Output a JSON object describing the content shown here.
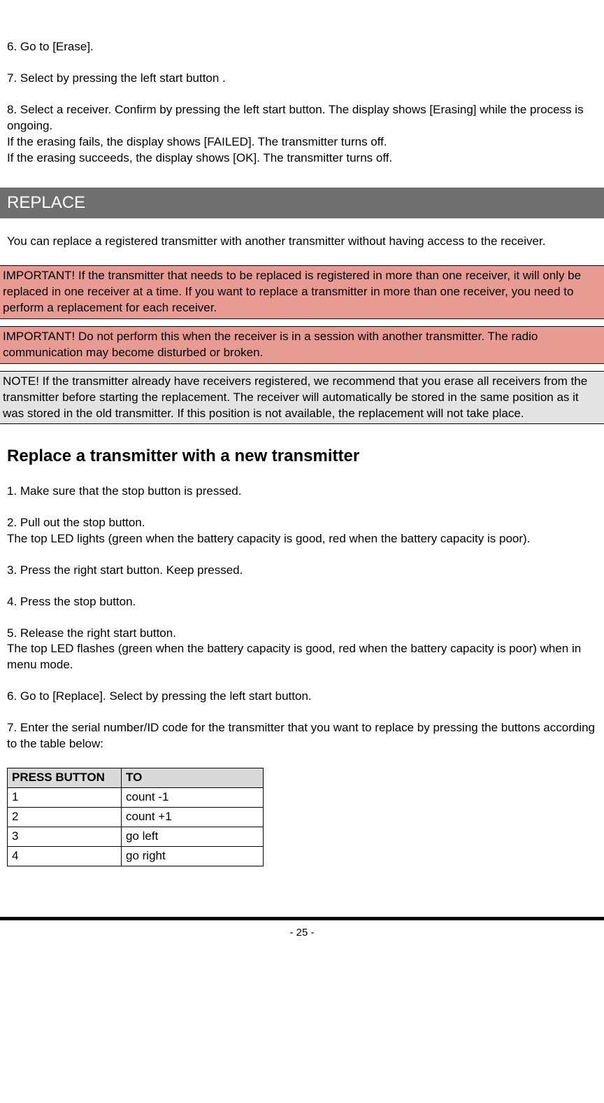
{
  "steps_top": {
    "s6": "6. Go to [Erase].",
    "s7": "7. Select by pressing the left start button .",
    "s8a": "8. Select a receiver. Confirm by pressing the left start button. The display shows [Erasing] while the process is ongoing.",
    "s8b": "If the erasing fails, the display shows [FAILED]. The transmitter turns off.",
    "s8c": "If the erasing succeeds, the display shows [OK]. The transmitter turns off."
  },
  "section_title": "REPLACE",
  "replace_intro": "You can replace a registered transmitter with another transmitter without having access to the receiver.",
  "important1": "IMPORTANT! If the transmitter that needs to be replaced is registered in more than one receiver, it will only be replaced in one receiver at a time. If you want to replace a transmitter in more than one receiver, you need to perform a replacement for each receiver.",
  "important2": "IMPORTANT! Do not perform this when the receiver is in a session with another transmitter. The radio communication may become disturbed or broken.",
  "note1": "NOTE! If the transmitter already have receivers registered, we recommend that you erase all receivers from the transmitter before starting the replacement. The receiver will automatically be stored in the same position as it was stored in the old transmitter. If this position is not available, the replacement will not take place.",
  "subheading": "Replace a transmitter with a new transmitter",
  "replace_steps": {
    "r1": "1. Make sure that the stop button is pressed.",
    "r2a": "2. Pull out the stop button.",
    "r2b": "The top LED lights (green when the battery capacity is good, red when the battery capacity is poor).",
    "r3": "3. Press the right start button. Keep pressed.",
    "r4": "4. Press the stop button.",
    "r5a": "5. Release the right start button.",
    "r5b": "The top LED flashes (green when the battery capacity is good, red when the battery capacity is poor) when in menu mode.",
    "r6": "6. Go to [Replace]. Select by pressing the left start button.",
    "r7": "7. Enter the serial number/ID code for the transmitter that you want to replace by pressing the buttons according to the table below:"
  },
  "table": {
    "header": {
      "c1": "PRESS BUTTON",
      "c2": "TO"
    },
    "rows": [
      {
        "c1": "1",
        "c2": "count -1"
      },
      {
        "c1": "2",
        "c2": "count +1"
      },
      {
        "c1": "3",
        "c2": "go left"
      },
      {
        "c1": "4",
        "c2": "go right"
      }
    ]
  },
  "page_number": "- 25 -"
}
